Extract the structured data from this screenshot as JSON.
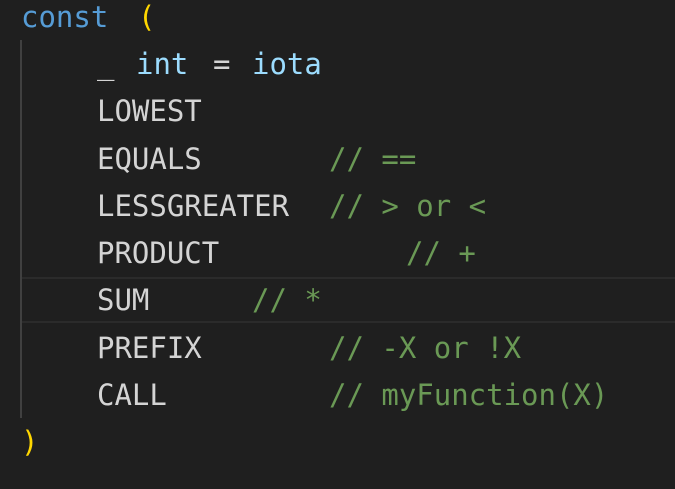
{
  "colors": {
    "background": "#1f1f1f",
    "keyword": "#569cd6",
    "identifier": "#9cdcfe",
    "type": "#4ec9b0",
    "paren": "#ffd700",
    "comment": "#6a9955",
    "text": "#d4d4d4"
  },
  "code": {
    "line1": {
      "keyword": "const",
      "paren": "("
    },
    "line2": {
      "blank": "_",
      "type": "int",
      "op": "=",
      "value": "iota"
    },
    "line3": {
      "name": "LOWEST"
    },
    "line4": {
      "name": "EQUALS",
      "comment": "// =="
    },
    "line5": {
      "name": "LESSGREATER",
      "comment": "// > or <"
    },
    "line6": {
      "name": "PRODUCT",
      "comment": "// +"
    },
    "line7": {
      "name": "SUM",
      "comment": "// *"
    },
    "line8": {
      "name": "PREFIX",
      "comment": "// -X or !X"
    },
    "line9": {
      "name": "CALL",
      "comment": "// myFunction(X)"
    },
    "line10": {
      "paren": ")"
    }
  }
}
